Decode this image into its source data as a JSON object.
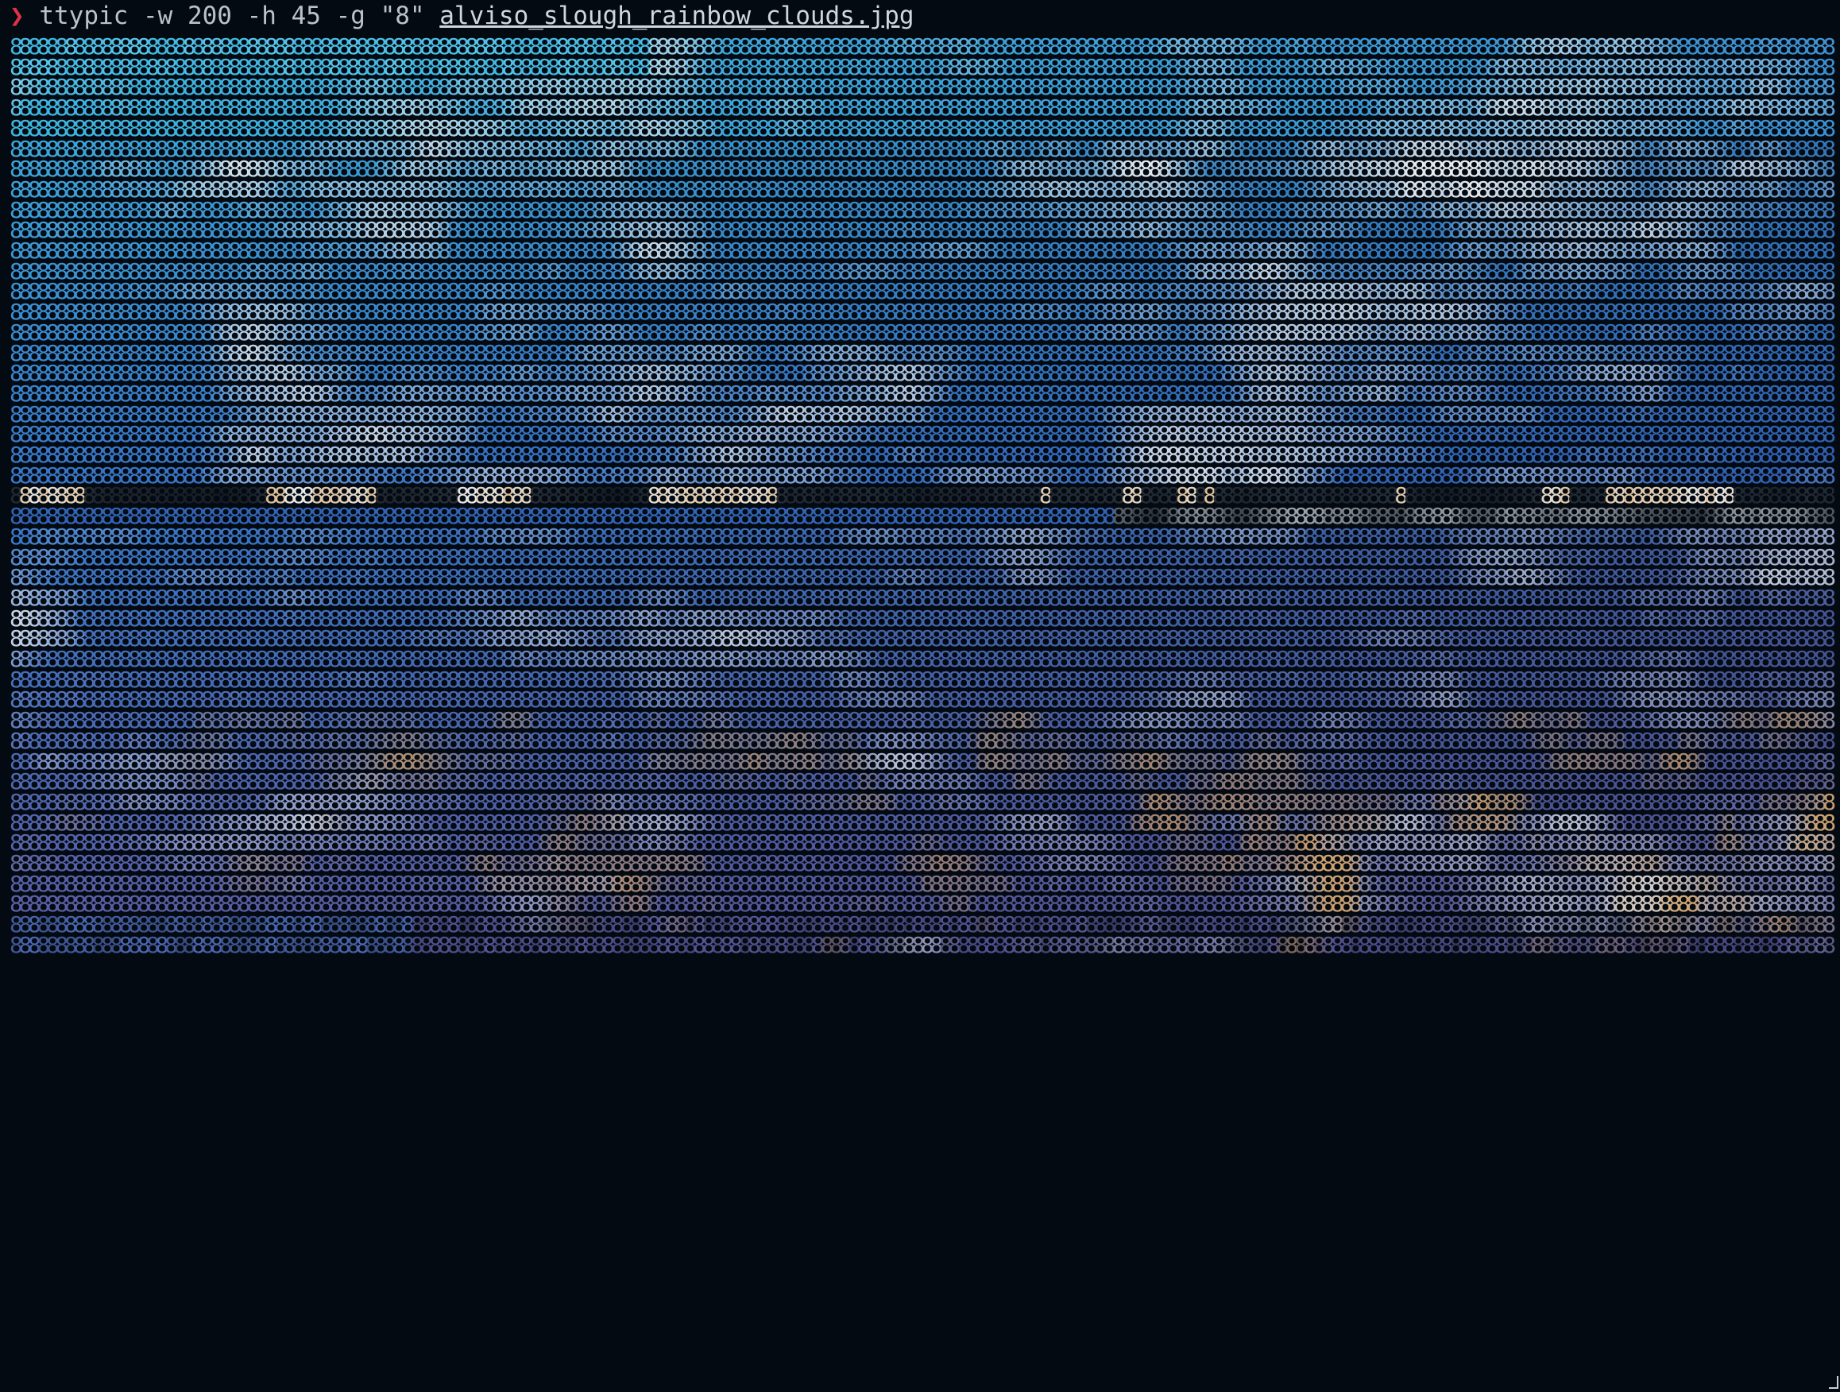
{
  "terminal": {
    "prompt_symbol": "❯",
    "command": "ttypic -w 200 -h 45 -g \"8\" ",
    "file_arg": "alviso_slough_rainbow_clouds.jpg"
  },
  "art": {
    "glyph": "8",
    "columns": 200,
    "rows": 45
  },
  "colors": {
    "background": "#040a12",
    "prompt": "#e0304a",
    "sky_cyan": "#3fb6e0",
    "sky_blue": "#3a78c8",
    "cloud_white": "#e6ecf2",
    "horizon_dark": "#0a1016",
    "horizon_light": "#f2f0e6",
    "warm_orange": "#d8a25c",
    "violet": "#6a5aa8"
  }
}
